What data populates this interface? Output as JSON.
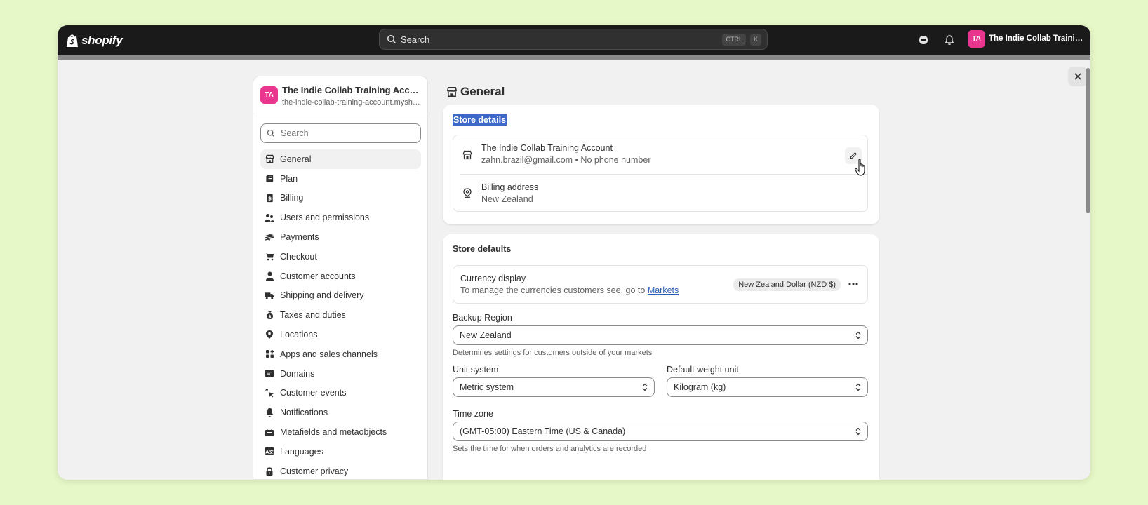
{
  "topbar": {
    "logo_text": "shopify",
    "search_placeholder": "Search",
    "shortcut_ctrl": "CTRL",
    "shortcut_k": "K",
    "avatar_initials": "TA",
    "store_name": "The Indie Collab Training ..."
  },
  "sidebar": {
    "avatar_initials": "TA",
    "store_name": "The Indie Collab Training Account",
    "store_url": "the-indie-collab-training-account.myshopify.com",
    "search_placeholder": "Search",
    "items": [
      {
        "label": "General",
        "icon": "store-icon",
        "active": true
      },
      {
        "label": "Plan",
        "icon": "plan-icon"
      },
      {
        "label": "Billing",
        "icon": "billing-icon"
      },
      {
        "label": "Users and permissions",
        "icon": "users-icon"
      },
      {
        "label": "Payments",
        "icon": "payments-icon"
      },
      {
        "label": "Checkout",
        "icon": "cart-icon"
      },
      {
        "label": "Customer accounts",
        "icon": "person-icon"
      },
      {
        "label": "Shipping and delivery",
        "icon": "truck-icon"
      },
      {
        "label": "Taxes and duties",
        "icon": "money-bag-icon"
      },
      {
        "label": "Locations",
        "icon": "location-pin-icon"
      },
      {
        "label": "Apps and sales channels",
        "icon": "apps-icon"
      },
      {
        "label": "Domains",
        "icon": "domains-icon"
      },
      {
        "label": "Customer events",
        "icon": "cursor-click-icon"
      },
      {
        "label": "Notifications",
        "icon": "bell-icon"
      },
      {
        "label": "Metafields and metaobjects",
        "icon": "metafields-icon"
      },
      {
        "label": "Languages",
        "icon": "language-icon"
      },
      {
        "label": "Customer privacy",
        "icon": "lock-icon"
      }
    ]
  },
  "page": {
    "title": "General"
  },
  "store_details": {
    "title": "Store details",
    "store_name": "The Indie Collab Training Account",
    "contact": "zahn.brazil@gmail.com • No phone number",
    "billing_label": "Billing address",
    "billing_value": "New Zealand"
  },
  "store_defaults": {
    "title": "Store defaults",
    "currency_label": "Currency display",
    "currency_help_prefix": "To manage the currencies customers see, go to ",
    "currency_help_link": "Markets",
    "currency_badge": "New Zealand Dollar (NZD $)",
    "backup_region_label": "Backup Region",
    "backup_region_value": "New Zealand",
    "backup_region_help": "Determines settings for customers outside of your markets",
    "unit_system_label": "Unit system",
    "unit_system_value": "Metric system",
    "weight_unit_label": "Default weight unit",
    "weight_unit_value": "Kilogram (kg)",
    "timezone_label": "Time zone",
    "timezone_value": "(GMT-05:00) Eastern Time (US & Canada)",
    "timezone_help": "Sets the time for when orders and analytics are recorded"
  },
  "colors": {
    "accent_avatar": "#e8368f",
    "selection_highlight": "#3d67c9",
    "link": "#2a5fb8",
    "topbar": "#1a1a1a"
  }
}
